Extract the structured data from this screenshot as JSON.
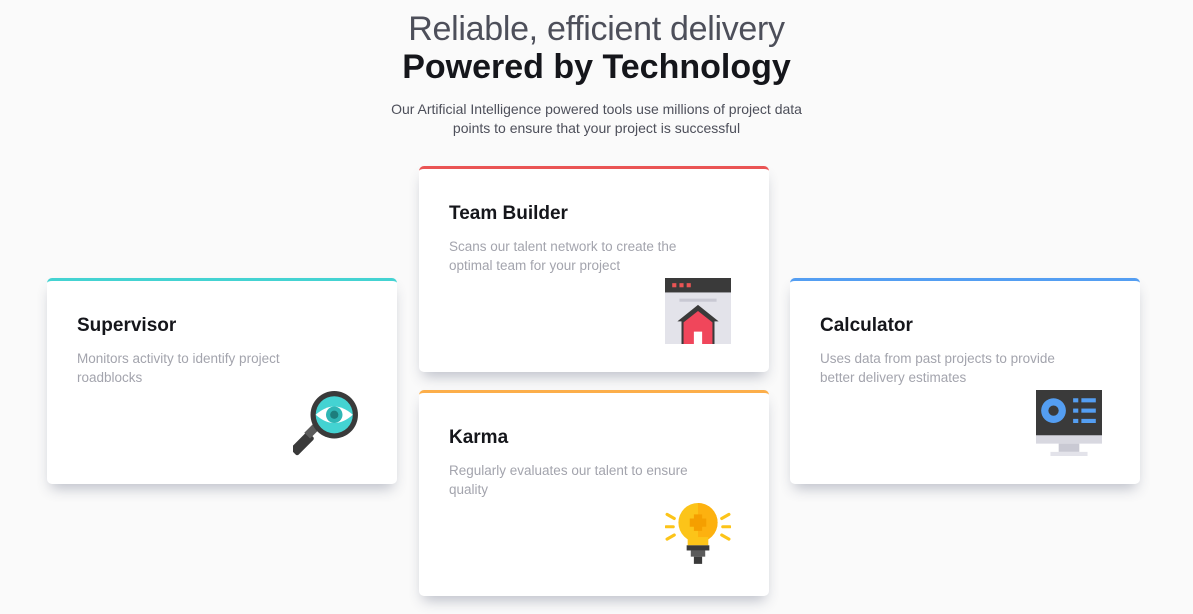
{
  "header": {
    "light_title": "Reliable, efficient delivery",
    "bold_title": "Powered by Technology",
    "description": "Our Artificial Intelligence powered tools use millions of project data points to ensure that your project is successful"
  },
  "cards": [
    {
      "title": "Supervisor",
      "text": "Monitors activity to identify project roadblocks",
      "accent": "#44d3d2",
      "icon": "magnifier-eye-icon"
    },
    {
      "title": "Team Builder",
      "text": "Scans our talent network to create the optimal team for your project",
      "accent": "#ea5454",
      "icon": "browser-house-icon"
    },
    {
      "title": "Karma",
      "text": "Regularly evaluates our talent to ensure quality",
      "accent": "#fcae4a",
      "icon": "lightbulb-icon"
    },
    {
      "title": "Calculator",
      "text": "Uses data from past projects to provide better delivery estimates",
      "accent": "#549ef2",
      "icon": "monitor-chart-icon"
    }
  ]
}
